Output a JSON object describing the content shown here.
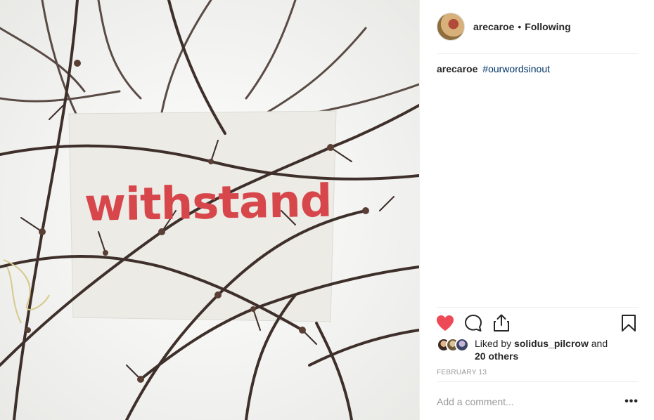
{
  "post": {
    "author": "arecaroe",
    "follow_separator": "•",
    "follow_status": "Following",
    "caption": {
      "username": "arecaroe",
      "hashtag": "#ourwordsinout"
    },
    "image": {
      "card_text": "withstand"
    },
    "likes": {
      "prefix": "Liked by ",
      "first_user": "solidus_pilcrow",
      "joiner": " and",
      "others": "20 others"
    },
    "date": "FEBRUARY 13",
    "comment": {
      "placeholder": "Add a comment...",
      "more_label": "•••"
    }
  },
  "icons": {
    "like": "heart-filled-icon",
    "comment": "speech-bubble-icon",
    "share": "share-upload-icon",
    "save": "bookmark-icon",
    "more": "ellipsis-icon"
  },
  "colors": {
    "heart": "#ed4956",
    "hashtag": "#003569",
    "muted": "#999999",
    "word": "#d7464a"
  }
}
